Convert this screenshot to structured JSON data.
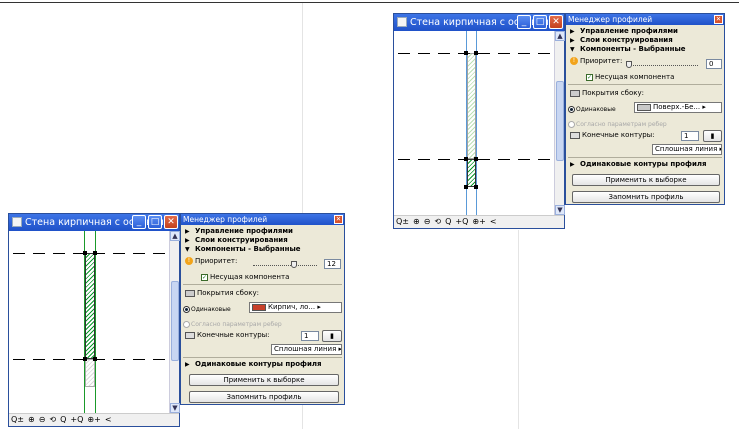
{
  "window_left": {
    "title": "Стена кирпичная с основани...",
    "bottom_icons": [
      "Q±",
      "⊕",
      "⊖",
      "⟲",
      "Q",
      "+Q",
      "⊕+",
      "<"
    ],
    "panel": {
      "title": "Менеджер профилей",
      "sections": [
        "Управление профилями",
        "Слои конструирования",
        "Компоненты - Выбранные"
      ],
      "priority_label": "Приоритет:",
      "priority_value": "12",
      "load_bearing_label": "Несущая компонента",
      "side_coating_label": "Покрытия сбоку:",
      "same_label": "Одинаковые",
      "material": "Кирпич, ло...",
      "by_ribs_label": "Согласно параметрам ребер",
      "end_contours_label": "Конечные контуры:",
      "end_contours_value": "1",
      "line_type": "Сплошная линия",
      "same_contours": "Одинаковые контуры профиля",
      "apply_button": "Применить к выборке",
      "save_button": "Запомнить профиль"
    }
  },
  "window_right": {
    "title": "Стена кирпичная с основани...",
    "bottom_icons": [
      "Q±",
      "⊕",
      "⊖",
      "⟲",
      "Q",
      "+Q",
      "⊕+",
      "<"
    ],
    "panel": {
      "title": "Менеджер профилей",
      "sections": [
        "Управление профилями",
        "Слои конструирования",
        "Компоненты - Выбранные"
      ],
      "priority_label": "Приоритет:",
      "priority_value": "0",
      "load_bearing_label": "Несущая компонента",
      "side_coating_label": "Покрытия сбоку:",
      "same_label": "Одинаковые",
      "material": "Поверх.-Бе...",
      "by_ribs_label": "Согласно параметрам ребер",
      "end_contours_label": "Конечные контуры:",
      "end_contours_value": "1",
      "line_type": "Сплошная линия",
      "same_contours": "Одинаковые контуры профиля",
      "apply_button": "Применить к выборке",
      "save_button": "Запомнить профиль"
    }
  },
  "colors": {
    "titlebar": "#1f51c8",
    "hatch": "#0a9a2a",
    "panel_bg": "#ece9d8",
    "material_red": "#c8402a"
  }
}
